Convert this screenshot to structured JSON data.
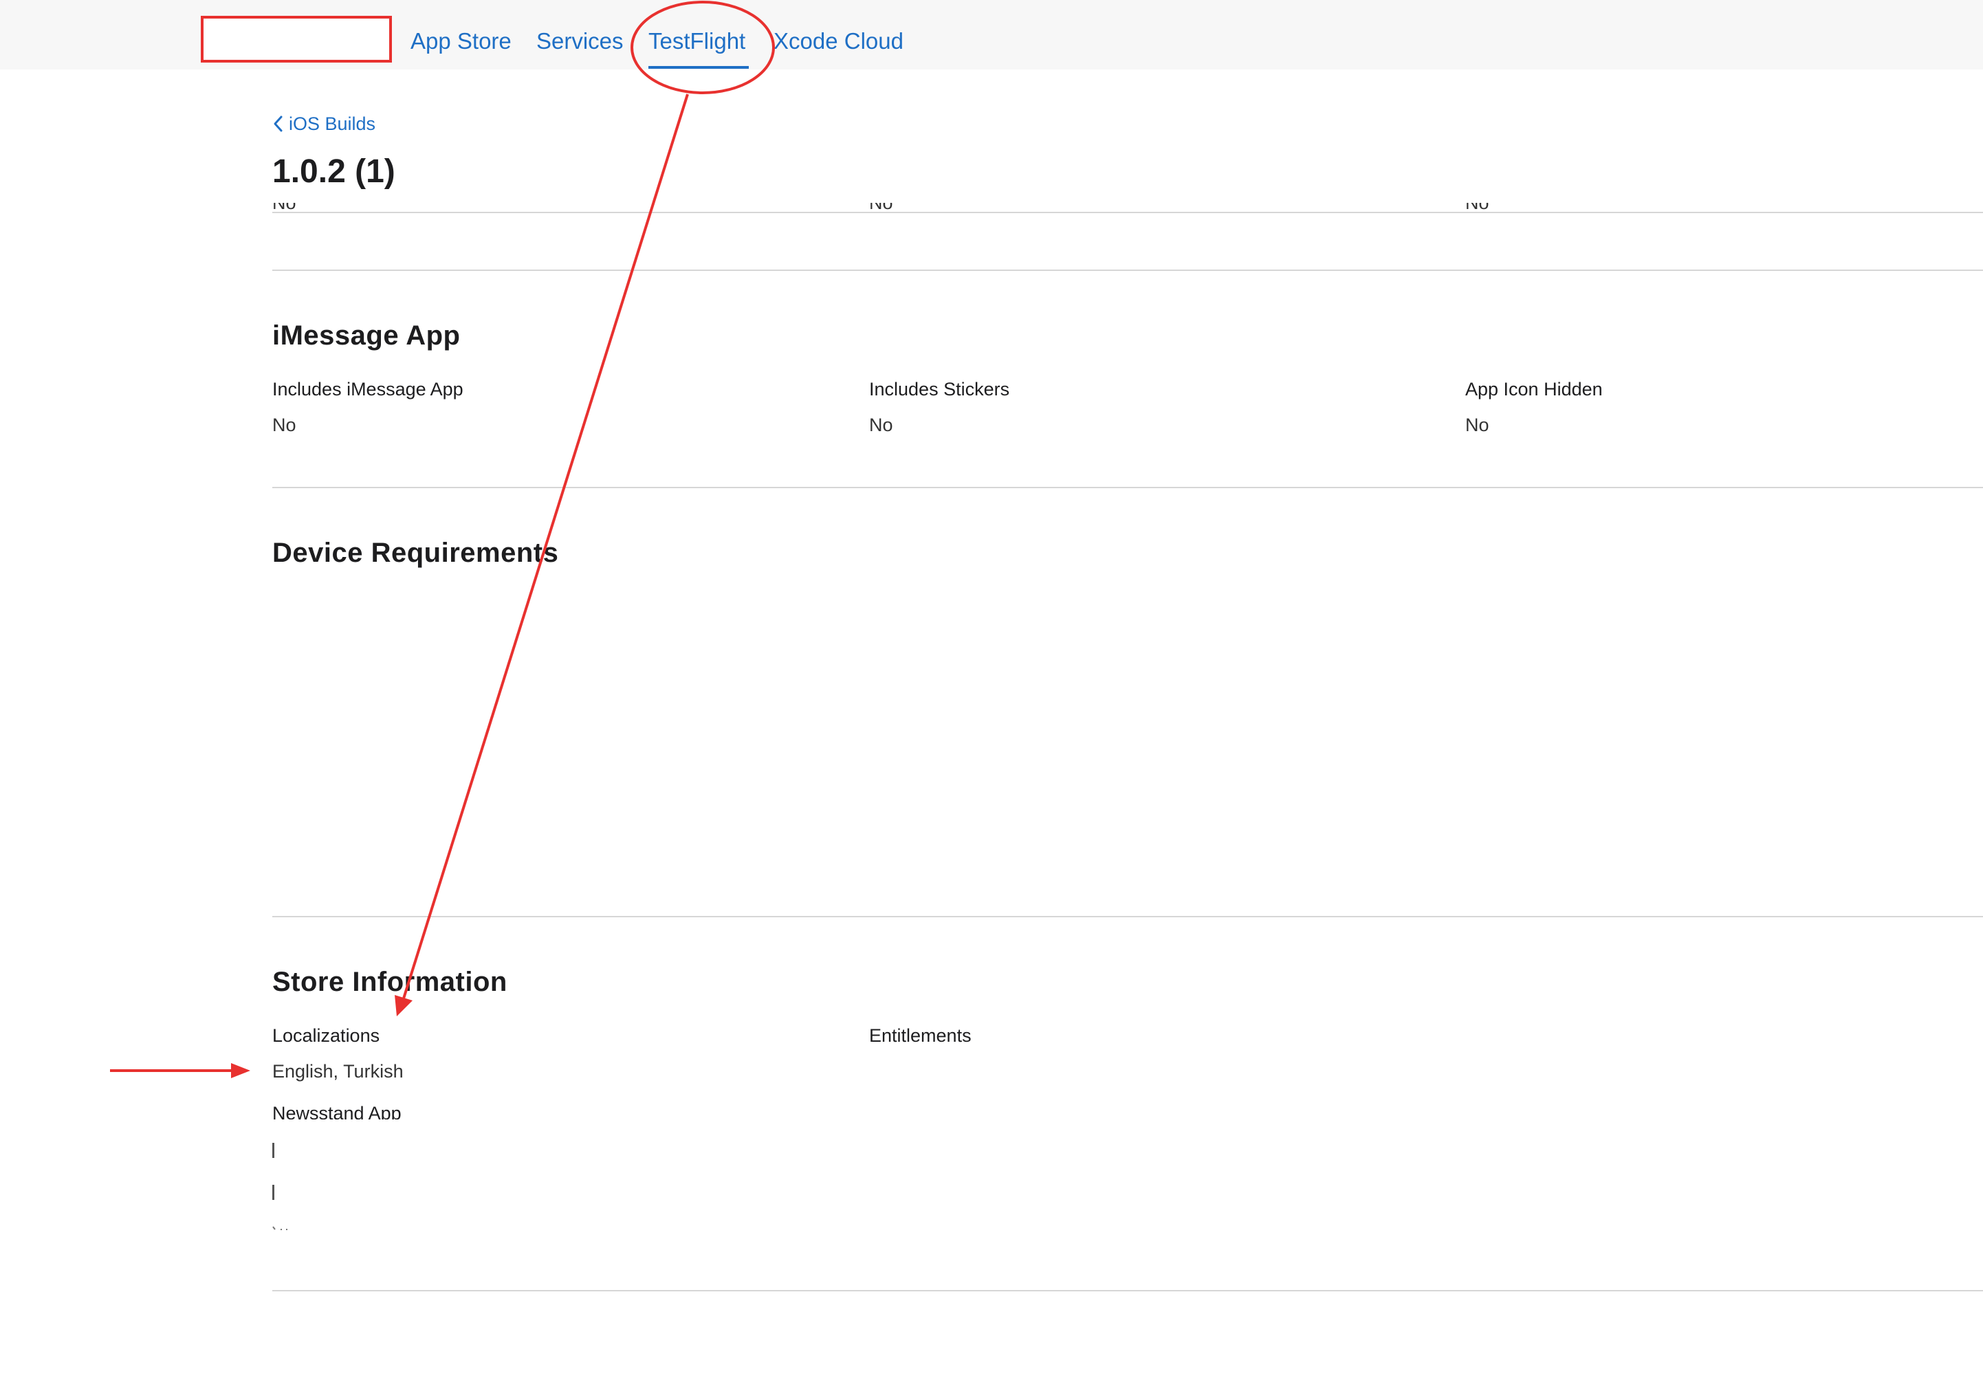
{
  "nav": {
    "items": [
      "App Store",
      "Services",
      "TestFlight",
      "Xcode Cloud"
    ],
    "active": "TestFlight"
  },
  "breadcrumb": {
    "back_label": "iOS Builds"
  },
  "page_title": "1.0.2 (1)",
  "clipped_row": [
    "No",
    "No",
    "No"
  ],
  "imessage": {
    "title": "iMessage App",
    "fields": [
      {
        "label": "Includes iMessage App",
        "value": "No"
      },
      {
        "label": "Includes Stickers",
        "value": "No"
      },
      {
        "label": "App Icon Hidden",
        "value": "No"
      }
    ]
  },
  "device_requirements": {
    "title": "Device Requirements"
  },
  "store_information": {
    "title": "Store Information",
    "localizations_label": "Localizations",
    "localizations_value": "English, Turkish",
    "entitlements_label": "Entitlements",
    "newsstand_label": "Newsstand App"
  },
  "colors": {
    "link": "#1f6fc5",
    "annotation_red": "#e8312f",
    "topbar_bg": "#f7f7f7",
    "divider": "#d6d6d6"
  }
}
